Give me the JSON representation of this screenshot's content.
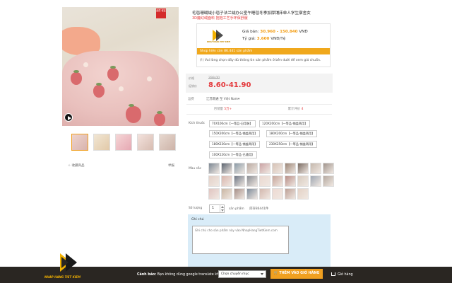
{
  "product": {
    "title": "毛毯珊瑚絨小毯子法兰絨办公室午睡毯冬季加厚铺床单人学生宿舍女",
    "subtitle": "3D魔幻绒面料 抱抱工艺手环保舒服",
    "badge": "品质 保证"
  },
  "price_box": {
    "logo_text": "NHAP HANG TIET KIEM",
    "price_vnd_label": "Giá bán:",
    "price_vnd_value": "30.960 - 150.840",
    "price_vnd_unit": "VNĐ",
    "rate_label": "Tỷ giá:",
    "rate_value": "3.600",
    "rate_unit": "VNĐ/Tệ",
    "shop_bar": "Shop hiện còn 86.441 sản phẩm",
    "note": "(!) Vui lòng chọn đầy đủ thông tin sản phẩm ở bên dưới để xem giá chuẩn."
  },
  "pricing": {
    "old_label": "价格",
    "old_price": "299.00",
    "new_label": "促销价",
    "new_price": "8.60-41.90"
  },
  "shipping": {
    "label": "运费",
    "value": "江苏南通 至 Việt Nam▾"
  },
  "stats": {
    "monthly_label": "月销量",
    "monthly_value": "5万+",
    "reviews_label": "累计评价",
    "reviews_value": "4"
  },
  "size": {
    "label": "Kích thước",
    "options": [
      "70X100cm【一等品-日用装】",
      "120X200cm【一等品-铺盖两用】",
      "150X200cm【一等品-铺盖两用】",
      "180X200cm【一等品-铺盖两用】",
      "180X230cm【一等品-铺盖两用】",
      "230X250cm【一等品-铺盖两用】",
      "100X120cm【一等品-已通用】"
    ]
  },
  "color": {
    "label": "Màu sắc",
    "swatches": [
      "#7c8894",
      "#5b6470",
      "#8a9aa6",
      "#b9aaa2",
      "#caa3a4",
      "#d6c2b6",
      "#9b8576",
      "#7a6b62",
      "#c5b8ad",
      "#a0948c",
      "#e3d0c7",
      "#d8b6ad",
      "#6e7785",
      "#8c8f95",
      "#ead8d0",
      "#c7a69b",
      "#b88f88",
      "#d7cbbf",
      "#9fa7b2",
      "#b5a9a0",
      "#e0c4c0",
      "#c9b6a3",
      "#a58f88",
      "#7f8c9a",
      "#d3b8ae",
      "#edd9d2",
      "#bda096",
      "#e4d2c6"
    ]
  },
  "quantity": {
    "label": "Số lượng",
    "value": "1",
    "unit": "sản phẩm",
    "stock": "库存86441件"
  },
  "notes": {
    "title": "Ghi chú",
    "placeholder": "Ghi chú cho sản phẩm này vào NhapHangTietKiem.com"
  },
  "gallery": {
    "favorite": "☆ 收藏商品",
    "report": "举报"
  },
  "bottom_bar": {
    "brand": "NHAP HANG TIET KIEM",
    "warning_bold": "Cảnh báo:",
    "warning_text": "Bạn không dùng google translate khi thêm sản phẩm!",
    "category_select": "Chọn chuyên mục",
    "add_button": "THÊM VÀO GIỎ HÀNG",
    "cart_label": "Giỏ hàng"
  }
}
